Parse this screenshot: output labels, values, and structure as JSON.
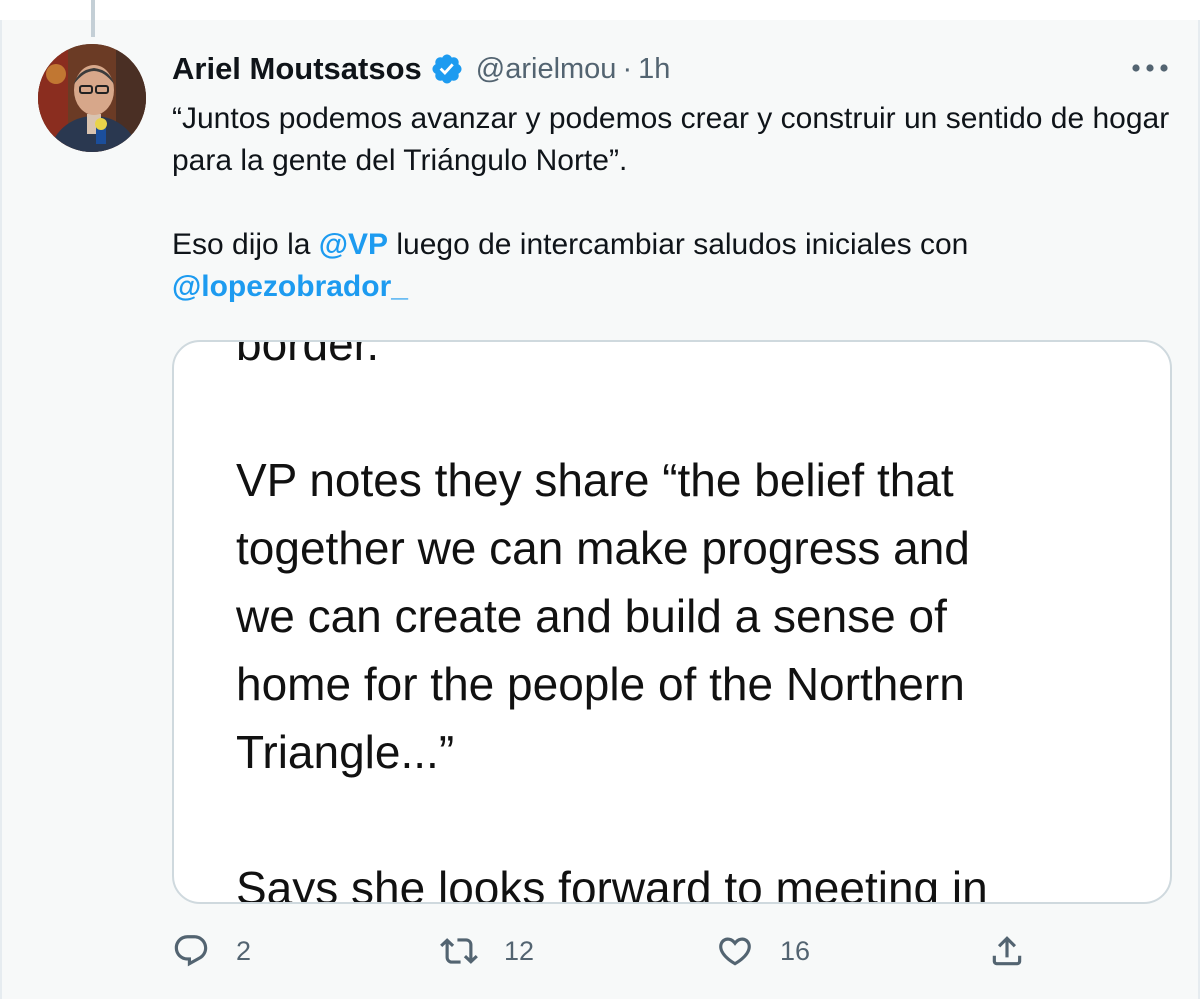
{
  "tweet": {
    "author_name": "Ariel Moutsatsos",
    "handle": "@arielmou",
    "separator": "·",
    "time": "1h",
    "text": {
      "line1": "“Juntos podemos avanzar y podemos crear y construir un sentido de hogar para la gente del Triángulo Norte”.",
      "para2_prefix": "Eso dijo la ",
      "mention1": "@VP",
      "para2_middle": " luego de intercambiar saludos iniciales con ",
      "mention2": "@lopezobrador_"
    },
    "media": {
      "line_top": "border.",
      "para": [
        "VP notes they share “the belief that",
        "together we can make progress and",
        "we can create and build a sense of",
        "home for the people of the Northern",
        "Triangle...”"
      ],
      "line_bottom": "Says she looks forward to meeting in"
    },
    "actions": {
      "reply_count": "2",
      "retweet_count": "12",
      "like_count": "16"
    }
  },
  "icons": {
    "verified": "verified-badge-icon",
    "more": "more-options-icon",
    "reply": "reply-icon",
    "retweet": "retweet-icon",
    "like": "heart-icon",
    "share": "share-icon"
  },
  "colors": {
    "accent": "#1d9bf0",
    "text": "#0f1419",
    "secondary": "#536471",
    "background": "#f7f9f9",
    "border": "#cfd9de"
  }
}
